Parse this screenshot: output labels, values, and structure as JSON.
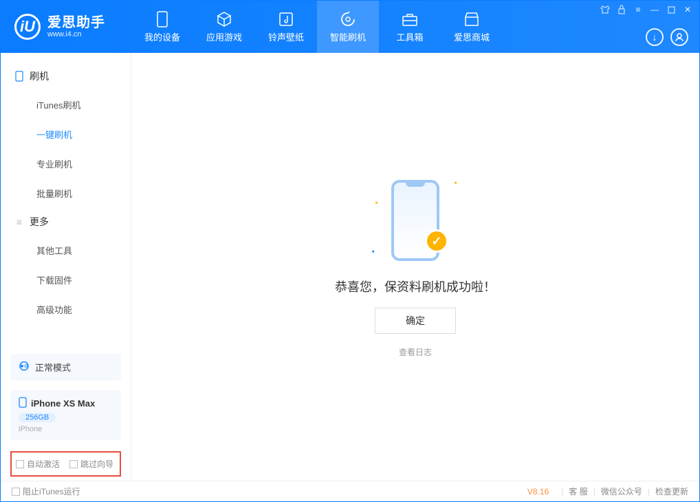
{
  "app": {
    "title": "爱思助手",
    "subtitle": "www.i4.cn",
    "logo_letter": "iU"
  },
  "header_tabs": [
    {
      "label": "我的设备",
      "icon": "device-icon"
    },
    {
      "label": "应用游戏",
      "icon": "cube-icon"
    },
    {
      "label": "铃声壁纸",
      "icon": "music-icon"
    },
    {
      "label": "智能刷机",
      "icon": "refresh-icon",
      "active": true
    },
    {
      "label": "工具箱",
      "icon": "toolbox-icon"
    },
    {
      "label": "爱思商城",
      "icon": "store-icon"
    }
  ],
  "sidebar": {
    "section1_title": "刷机",
    "section1_items": [
      {
        "label": "iTunes刷机"
      },
      {
        "label": "一键刷机",
        "active": true
      },
      {
        "label": "专业刷机"
      },
      {
        "label": "批量刷机"
      }
    ],
    "section2_title": "更多",
    "section2_items": [
      {
        "label": "其他工具"
      },
      {
        "label": "下载固件"
      },
      {
        "label": "高级功能"
      }
    ],
    "mode_label": "正常模式",
    "device_name": "iPhone XS Max",
    "device_capacity": "256GB",
    "device_type": "iPhone",
    "checkbox1": "自动激活",
    "checkbox2": "跳过向导"
  },
  "main": {
    "success_message": "恭喜您，保资料刷机成功啦！",
    "ok_button": "确定",
    "view_log": "查看日志"
  },
  "footer": {
    "block_itunes": "阻止iTunes运行",
    "version": "V8.16",
    "link1": "客 服",
    "link2": "微信公众号",
    "link3": "检查更新"
  }
}
